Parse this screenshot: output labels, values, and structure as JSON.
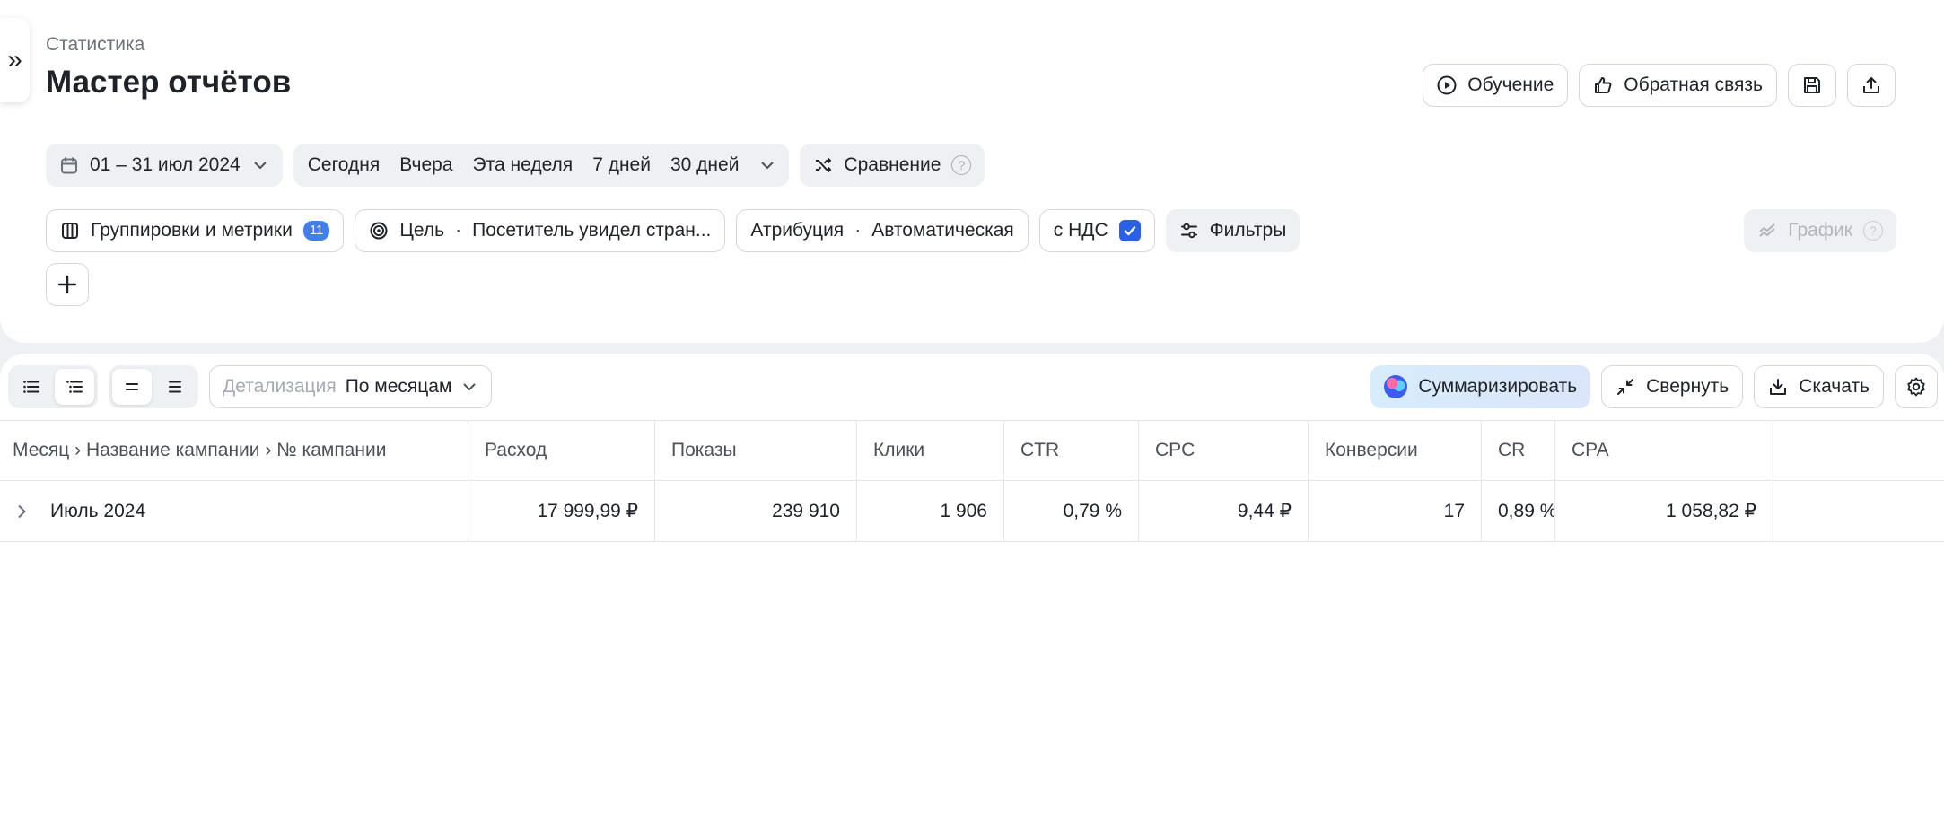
{
  "breadcrumb": "Статистика",
  "title": "Мастер отчётов",
  "header_actions": {
    "learning": "Обучение",
    "feedback": "Обратная связь"
  },
  "date_range": "01 – 31 июл 2024",
  "presets": [
    "Сегодня",
    "Вчера",
    "Эта неделя",
    "7 дней",
    "30 дней"
  ],
  "comparison": "Сравнение",
  "groupings": {
    "label": "Группировки и метрики",
    "count": "11"
  },
  "goal": {
    "label": "Цель",
    "value": "Посетитель увидел стран..."
  },
  "attribution": {
    "label": "Атрибуция",
    "value": "Автоматическая"
  },
  "vat": {
    "label": "с НДС",
    "checked": true
  },
  "filters": "Фильтры",
  "graph": "График",
  "detail": {
    "label": "Детализация",
    "value": "По месяцам"
  },
  "table_actions": {
    "summarize": "Суммаризировать",
    "collapse": "Свернуть",
    "download": "Скачать"
  },
  "table": {
    "columns": [
      "Месяц › Название кампании › № кампании",
      "Расход",
      "Показы",
      "Клики",
      "CTR",
      "CPC",
      "Конверсии",
      "CR",
      "CPA",
      ""
    ],
    "rows": [
      [
        "Июль 2024",
        "17 999,99 ₽",
        "239 910",
        "1 906",
        "0,79 %",
        "9,44 ₽",
        "17",
        "0,89 %",
        "1 058,82 ₽",
        ""
      ]
    ]
  },
  "colors": {
    "accent": "#2a5fe8",
    "badge": "#3f7ff0",
    "panel_bg": "#eef0f4"
  }
}
